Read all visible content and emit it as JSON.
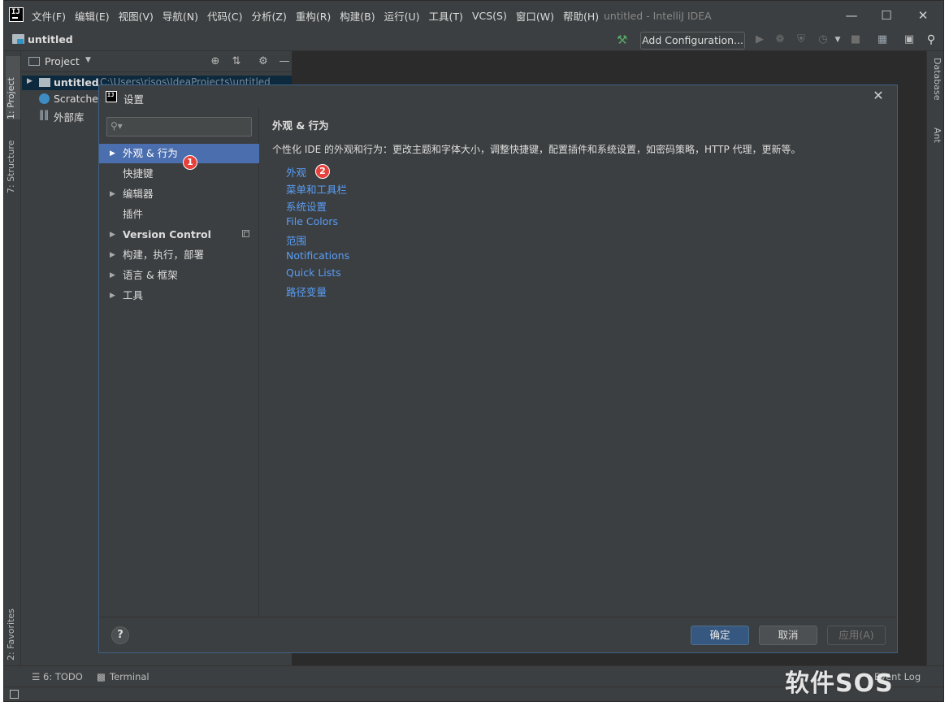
{
  "window": {
    "title": "untitled - IntelliJ IDEA",
    "menu": [
      "文件(F)",
      "编辑(E)",
      "视图(V)",
      "导航(N)",
      "代码(C)",
      "分析(Z)",
      "重构(R)",
      "构建(B)",
      "运行(U)",
      "工具(T)",
      "VCS(S)",
      "窗口(W)",
      "帮助(H)"
    ]
  },
  "navbar": {
    "project_name": "untitled",
    "add_configuration": "Add Configuration..."
  },
  "left_stripe": {
    "project_tab": "1: Project",
    "structure_tab": "7: Structure",
    "favorites_tab": "2: Favorites"
  },
  "right_stripe": {
    "database_tab": "Database",
    "ant_tab": "Ant"
  },
  "project_panel": {
    "title": "Project",
    "tree": [
      {
        "label": "untitled",
        "path": "C:\\Users\\risos\\IdeaProjects\\untitled"
      },
      {
        "label": "Scratches and Consoles"
      },
      {
        "label": "外部库"
      }
    ]
  },
  "bottom_tabs": {
    "todo": "6: TODO",
    "terminal": "Terminal",
    "event_log": "Event Log"
  },
  "dialog": {
    "title": "设置",
    "search_placeholder": "",
    "sidebar": [
      {
        "label": "外观 & 行为",
        "expandable": true,
        "selected": true,
        "bold": false
      },
      {
        "label": "快捷键",
        "expandable": false,
        "selected": false,
        "bold": false
      },
      {
        "label": "编辑器",
        "expandable": true,
        "selected": false,
        "bold": false
      },
      {
        "label": "插件",
        "expandable": false,
        "selected": false,
        "bold": false
      },
      {
        "label": "Version Control",
        "expandable": true,
        "selected": false,
        "bold": true
      },
      {
        "label": "构建，执行，部署",
        "expandable": true,
        "selected": false,
        "bold": false
      },
      {
        "label": "语言 & 框架",
        "expandable": true,
        "selected": false,
        "bold": false
      },
      {
        "label": "工具",
        "expandable": true,
        "selected": false,
        "bold": false
      }
    ],
    "content": {
      "heading": "外观 & 行为",
      "description": "个性化 IDE 的外观和行为：更改主题和字体大小，调整快捷键，配置插件和系统设置，如密码策略，HTTP 代理，更新等。",
      "links": [
        "外观",
        "菜单和工具栏",
        "系统设置",
        "File Colors",
        "范围",
        "Notifications",
        "Quick Lists",
        "路径变量"
      ]
    },
    "badges": [
      "1",
      "2"
    ],
    "buttons": {
      "help": "?",
      "ok": "确定",
      "cancel": "取消",
      "apply": "应用(A)"
    }
  },
  "watermark": "软件SOS",
  "colors": {
    "selection": "#4b6eaf",
    "link": "#589df6",
    "badge": "#e8403a",
    "editor_bg": "#2b2b2b",
    "panel_bg": "#3c3f41"
  },
  "icons": [
    "intellij-logo-icon",
    "folder-icon",
    "build-hammer-icon",
    "run-icon",
    "debug-icon",
    "coverage-icon",
    "profile-icon",
    "stop-icon",
    "project-structure-icon",
    "terminal-window-icon",
    "search-icon",
    "locate-icon",
    "collapse-icon",
    "gear-icon",
    "minimize-icon",
    "help-icon",
    "close-icon"
  ]
}
